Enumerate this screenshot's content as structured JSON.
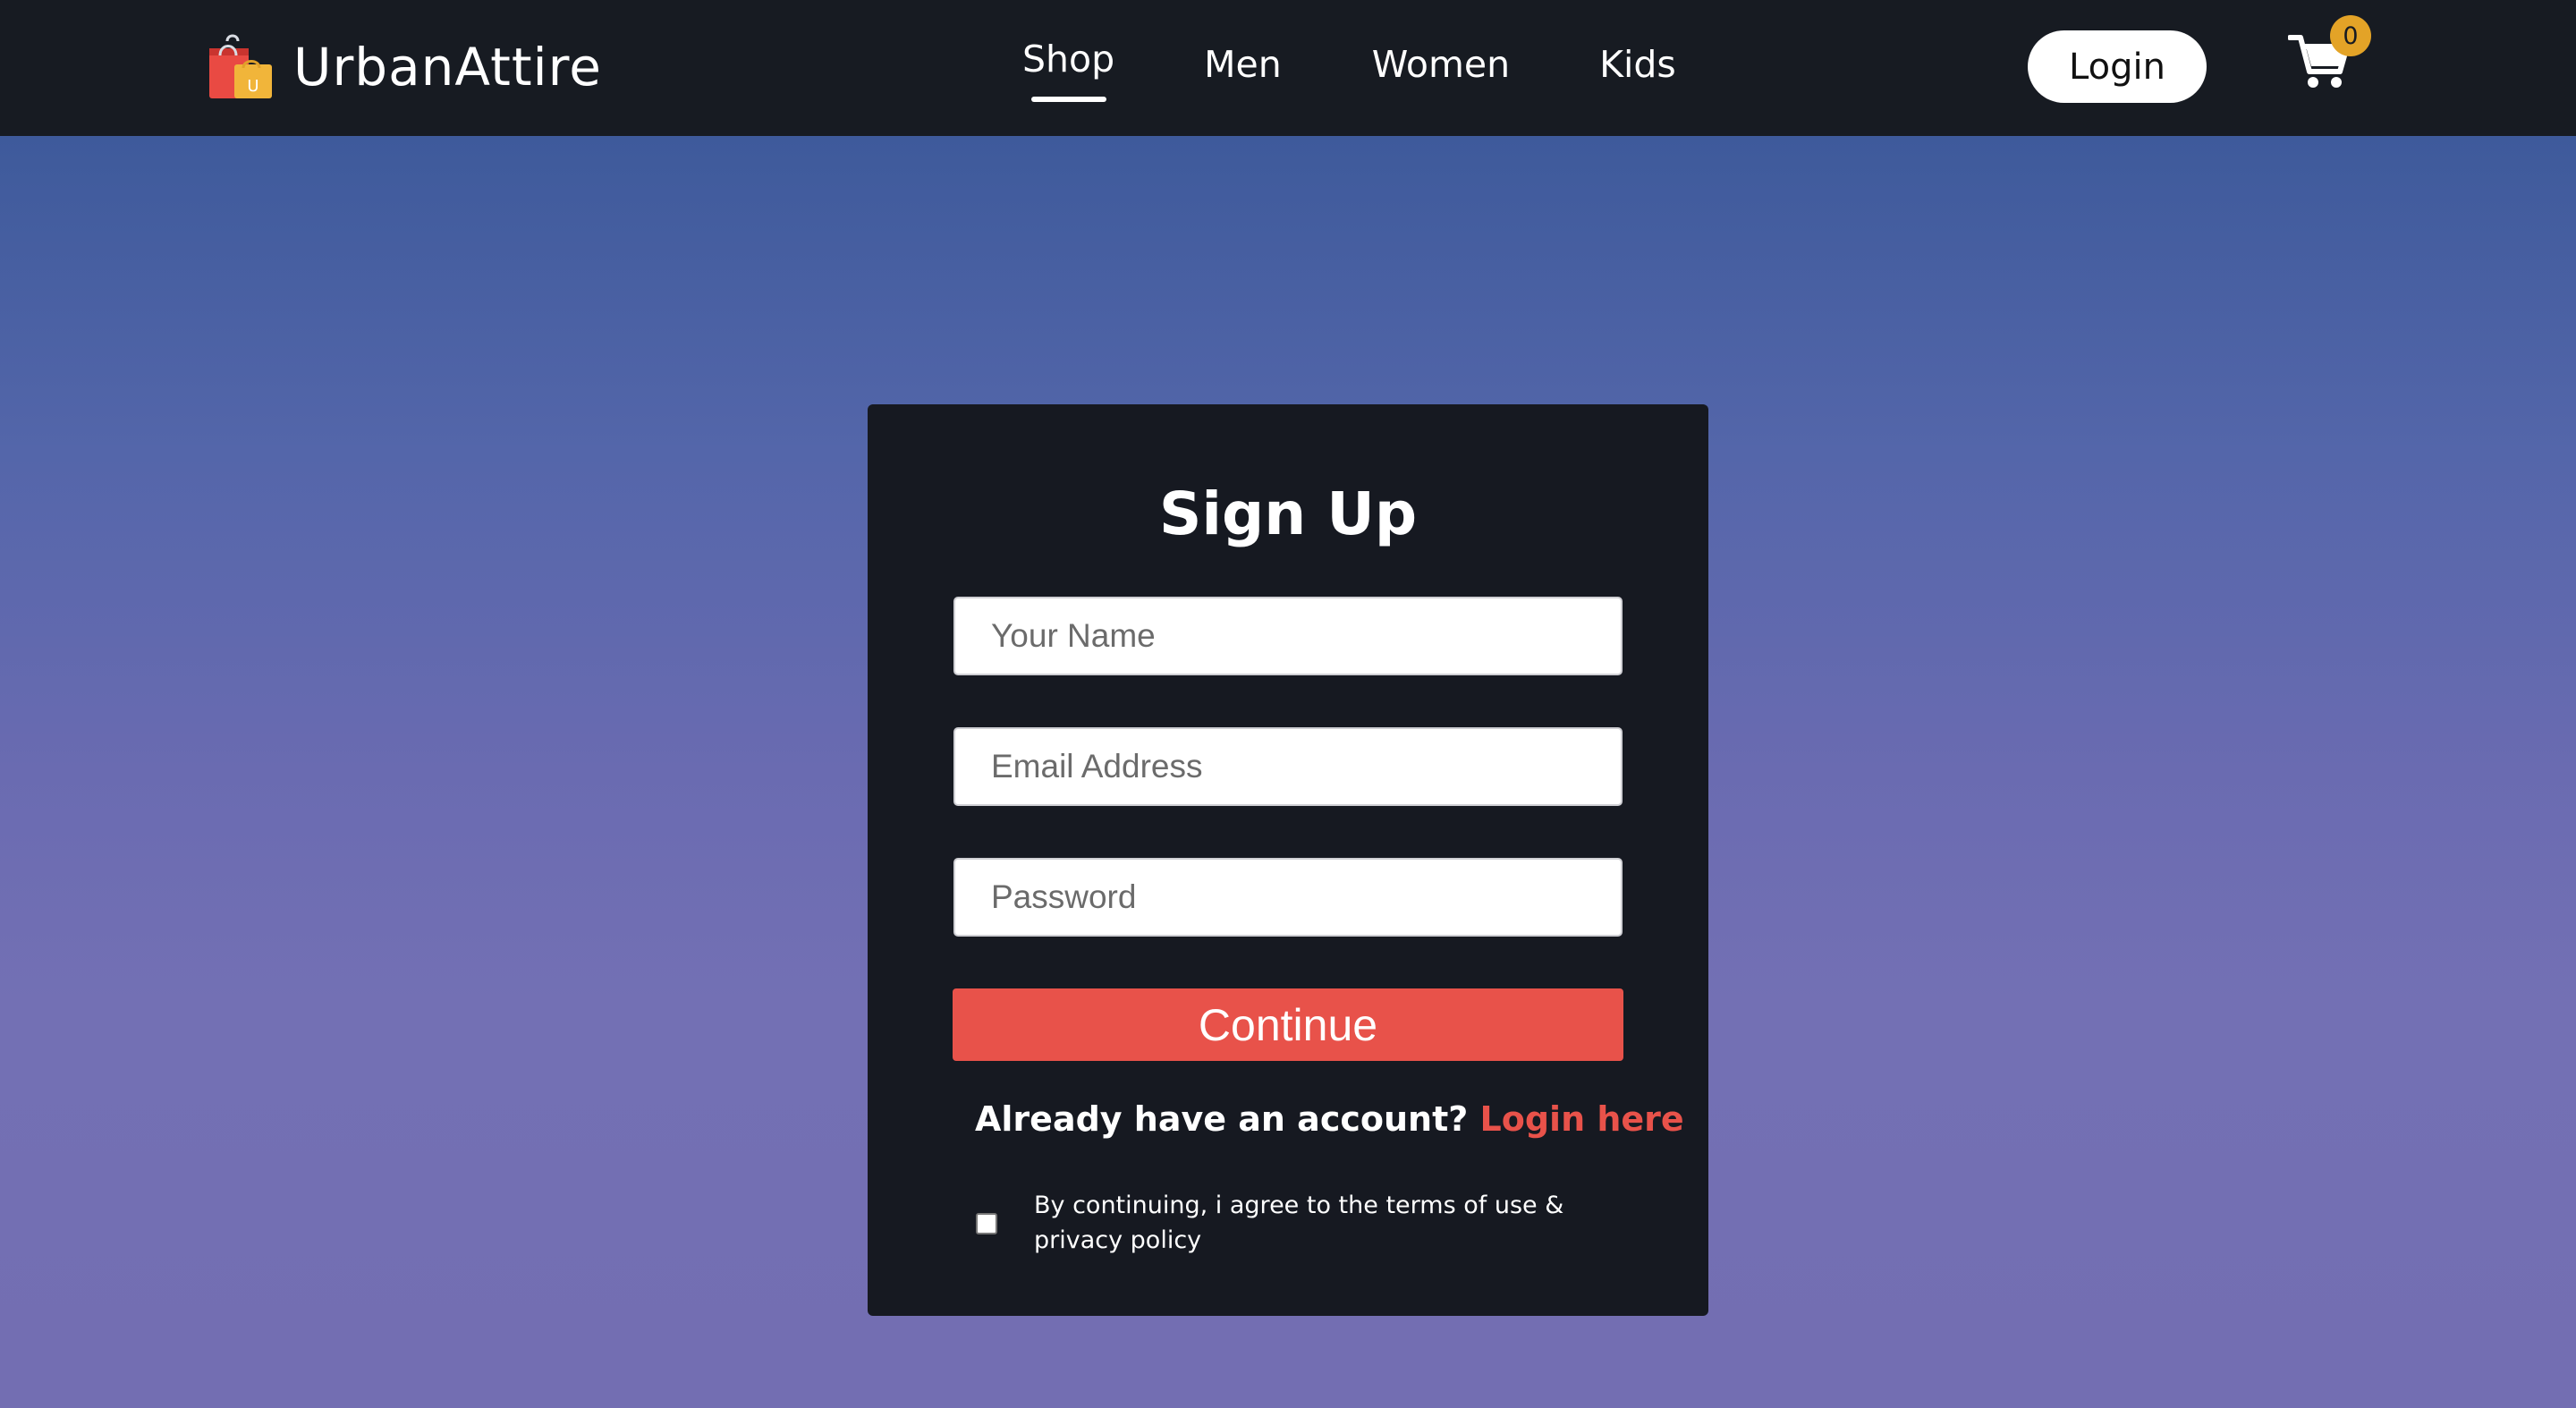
{
  "brand": {
    "name": "UrbanAttire",
    "icon": "shopping-bags-logo",
    "bag_letter": "U"
  },
  "nav": {
    "links": [
      {
        "label": "Shop",
        "active": true
      },
      {
        "label": "Men",
        "active": false
      },
      {
        "label": "Women",
        "active": false
      },
      {
        "label": "Kids",
        "active": false
      }
    ],
    "login_label": "Login",
    "cart_icon": "cart-icon",
    "cart_count": "0"
  },
  "colors": {
    "navbar_bg": "#171b22",
    "card_bg": "#161921",
    "accent_red": "#e8524a",
    "badge_gold": "#e3a327",
    "gradient_top": "#3e5a9b",
    "gradient_bottom": "#736eb2"
  },
  "signup": {
    "title": "Sign Up",
    "name_placeholder": "Your Name",
    "email_placeholder": "Email Address",
    "password_placeholder": "Password",
    "continue_label": "Continue",
    "account_prompt": "Already have an account? ",
    "login_link": "Login here",
    "terms_text": "By continuing, i agree to the terms of use & privacy policy",
    "terms_checked": false
  }
}
